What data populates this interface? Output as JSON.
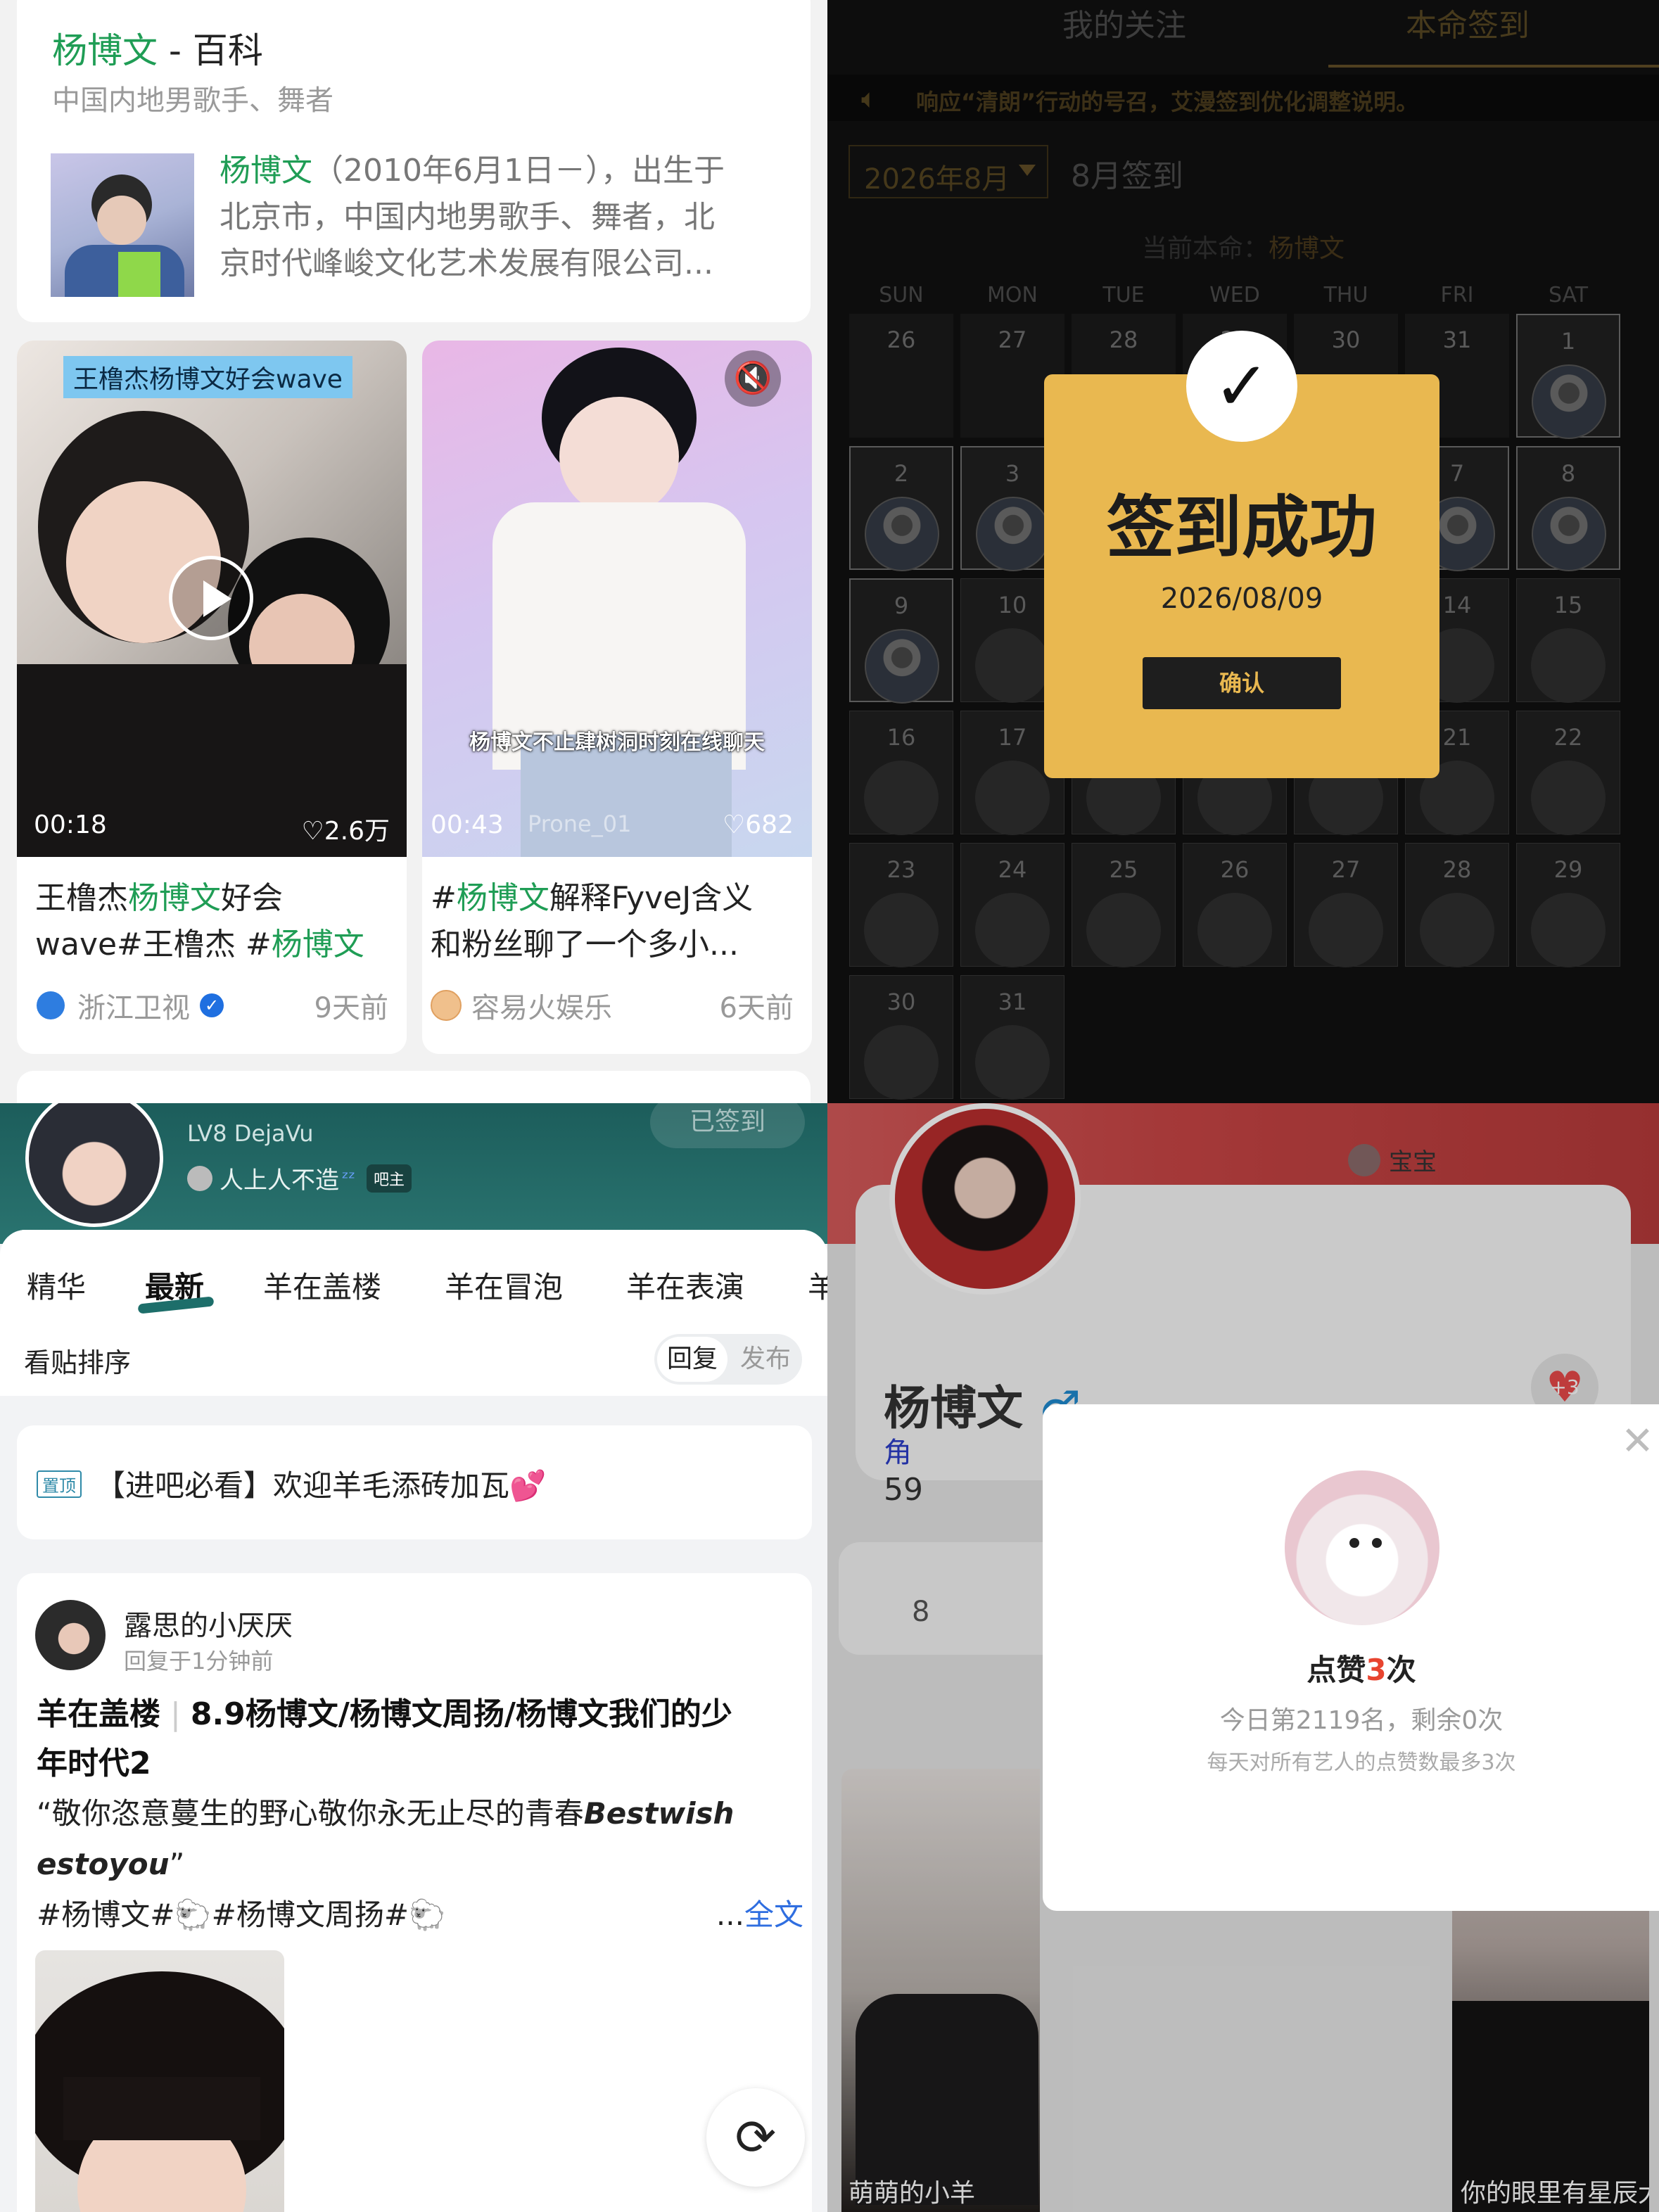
{
  "baike": {
    "name": "杨博文",
    "sep": " - ",
    "suffix": "百科",
    "subtitle": "中国内地男歌手、舞者",
    "desc_name": "杨博文",
    "desc_l1": "（2010年6月1日－），出生于",
    "desc_l2": "北京市，中国内地男歌手、舞者，北",
    "desc_l3": "京时代峰峻文化艺术发展有限公司..."
  },
  "video1": {
    "tag": "王橹杰杨博文好会wave",
    "time": "00:18",
    "likes": "2.6万",
    "title_l1_a": "王橹杰",
    "title_l1_b": "杨博文",
    "title_l1_c": "好会",
    "title_l2_a": "wave#王橹杰 #",
    "title_l2_b": "杨博文",
    "author": "浙江卫视",
    "ago": "9天前"
  },
  "video2": {
    "caption": "杨博文不止肆树洞时刻在线聊天",
    "time": "00:43",
    "watermark": "Prone_01",
    "likes": "682",
    "title_l1_a": "#",
    "title_l1_b": "杨博文",
    "title_l1_c": "解释FyveJ含义",
    "title_l2": "和粉丝聊了一个多小...",
    "author": "容易火娱乐",
    "ago": "6天前"
  },
  "checkin": {
    "tabs": [
      "我的关注",
      "本命签到"
    ],
    "notice": "响应“清朗”行动的号召，艾漫签到优化调整说明。",
    "month_select": "2026年8月",
    "month_title": "8月签到",
    "current_label": "当前本命：",
    "current_name": "杨博文",
    "weekdays": [
      "SUN",
      "MON",
      "TUE",
      "WED",
      "THU",
      "FRI",
      "SAT"
    ],
    "modal_title": "签到成功",
    "modal_date": "2026/08/09",
    "modal_button": "确认"
  },
  "tieba": {
    "level": "LV8 DejaVu",
    "motto": "人上人不造",
    "role_badge": "吧主",
    "checked": "已签到",
    "tabs": [
      "精华",
      "最新",
      "羊在盖楼",
      "羊在冒泡",
      "羊在表演",
      "羊"
    ],
    "sort_label": "看贴排序",
    "sort_options": [
      "回复",
      "发布"
    ],
    "pinned_badge": "置顶",
    "pinned_title": "【进吧必看】欢迎羊毛添砖加瓦💕",
    "post": {
      "author": "露思的小厌厌",
      "time": "回复于1分钟前",
      "category": "羊在盖楼",
      "title_l1": "8.9杨博文/杨博文周扬/杨博文我们的少",
      "title_l2": "年时代2",
      "body_l1_a": "“敬你恣意蔓生的野心敬你永无止尽的青春",
      "body_l1_b": "Bestwish",
      "body_l2": "estoyou",
      "body_l2_q": "”",
      "tags": "#杨博文#🐑#杨博文周扬#🐑",
      "more_dots": "...",
      "more": "全文"
    }
  },
  "profile": {
    "baby": "宝宝",
    "name": "杨博文",
    "gender": "♂",
    "role_char": "角",
    "num": "59",
    "heart_plus": "+3",
    "bg_num": "8",
    "card1_name": "萌萌的小羊",
    "card2_name": "你的眼里有星辰大海",
    "popup": {
      "pre": "点赞",
      "count": "3",
      "post": "次",
      "rank": "今日第2119名，剩余0次",
      "note": "每天对所有艺人的点赞数最多3次"
    }
  },
  "colors": {
    "green": "#1f9d55",
    "gold": "#e9b850",
    "red": "#e8442f",
    "blue": "#2f6ee0"
  }
}
